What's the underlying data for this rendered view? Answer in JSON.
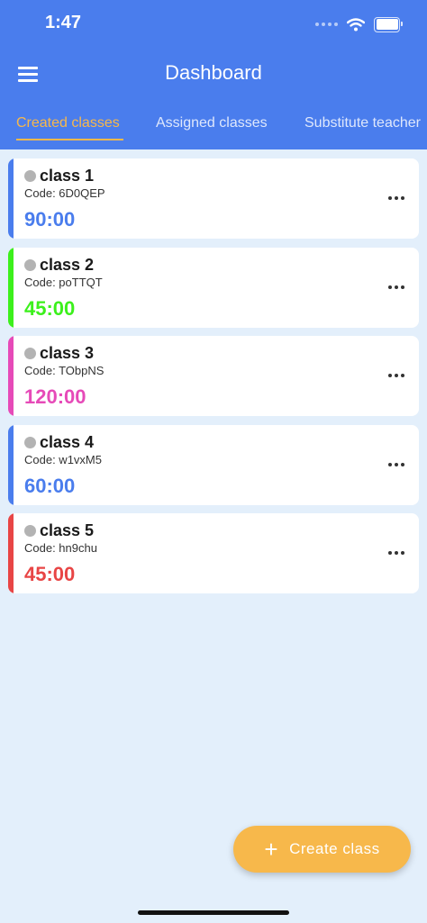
{
  "status_bar": {
    "time": "1:47"
  },
  "header": {
    "title": "Dashboard"
  },
  "tabs": [
    {
      "label": "Created classes",
      "active": true
    },
    {
      "label": "Assigned classes",
      "active": false
    },
    {
      "label": "Substitute teacher",
      "active": false
    }
  ],
  "classes": [
    {
      "name": "class 1",
      "code": "Code: 6D0QEP",
      "duration": "90:00",
      "color": "#4a7ded"
    },
    {
      "name": "class 2",
      "code": "Code: poTTQT",
      "duration": "45:00",
      "color": "#3cf01c"
    },
    {
      "name": "class 3",
      "code": "Code: TObpNS",
      "duration": "120:00",
      "color": "#e64ab8"
    },
    {
      "name": "class 4",
      "code": "Code: w1vxM5",
      "duration": "60:00",
      "color": "#4a7ded"
    },
    {
      "name": "class 5",
      "code": "Code: hn9chu",
      "duration": "45:00",
      "color": "#e84545"
    }
  ],
  "fab": {
    "label": "Create class",
    "icon": "plus-icon"
  },
  "colors": {
    "header": "#4a7ded",
    "accent": "#f7b84b",
    "background": "#e3effb"
  }
}
